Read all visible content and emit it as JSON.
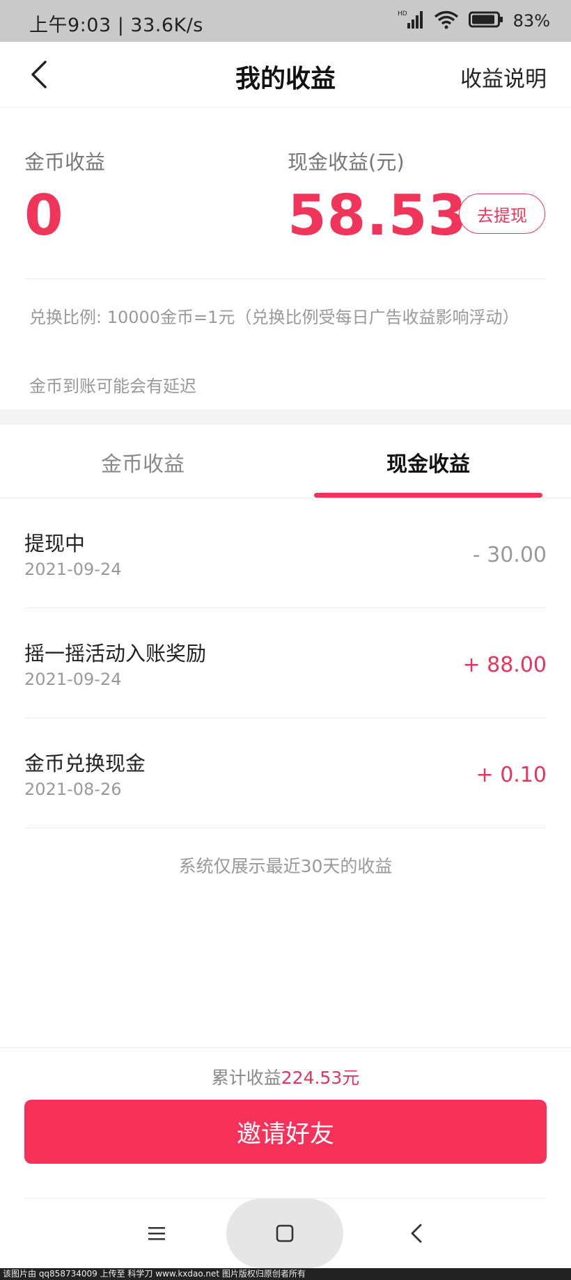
{
  "status_bar": {
    "time_speed": "上午9:03 | 33.6K/s",
    "network_badge": "HD",
    "battery_percent": "83%",
    "icons": [
      "signal-icon",
      "wifi-icon",
      "battery-icon"
    ]
  },
  "nav": {
    "back_icon": "chevron-left-icon",
    "title": "我的收益",
    "right_link": "收益说明"
  },
  "earnings": {
    "coin_label": "金币收益",
    "coin_value": "0",
    "cash_label": "现金收益(元)",
    "cash_value": "58.53",
    "withdraw_button": "去提现",
    "rate_text": "兑换比例: 10000金币=1元（兑换比例受每日广告收益影响浮动）",
    "delay_text": "金币到账可能会有延迟"
  },
  "tabs": {
    "coin": "金币收益",
    "cash": "现金收益",
    "active": "cash"
  },
  "records": [
    {
      "title": "提现中",
      "date": "2021-09-24",
      "amount": "- 30.00",
      "type": "neg"
    },
    {
      "title": "摇一摇活动入账奖励",
      "date": "2021-09-24",
      "amount": "+ 88.00",
      "type": "pos"
    },
    {
      "title": "金币兑换现金",
      "date": "2021-08-26",
      "amount": "+ 0.10",
      "type": "pos"
    }
  ],
  "note": "系统仅展示最近30天的收益",
  "footer": {
    "total_prefix": "累计收益",
    "total_value": "224.53元",
    "invite_button": "邀请好友"
  },
  "system_nav": {
    "icons": [
      "menu-icon",
      "home-icon",
      "back-triangle-icon"
    ]
  },
  "watermark": "该图片由 qq858734009 上传至 科学刀 www.kxdao.net 图片版权归原创者所有",
  "colors": {
    "accent": "#f0345a",
    "status_bar_bg": "#c9c9c9"
  }
}
